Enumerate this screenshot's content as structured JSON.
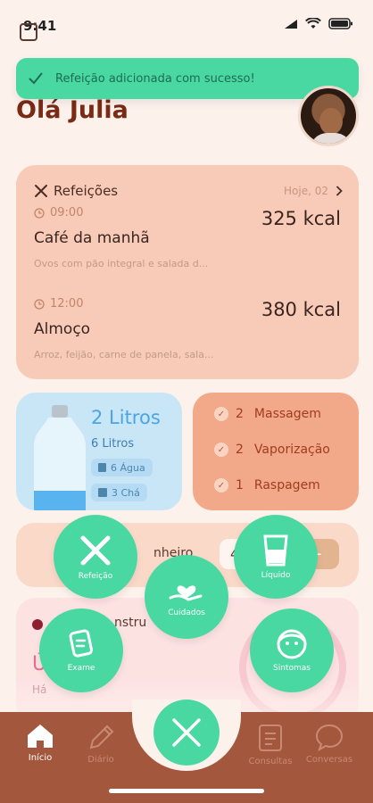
{
  "status_bar": {
    "time": "9:41"
  },
  "toast": {
    "message": "Refeição adicionada com sucesso!"
  },
  "greeting": "Olá Julia",
  "meals": {
    "title": "Refeições",
    "date": "Hoje, 02",
    "items": [
      {
        "time": "09:00",
        "name": "Café da manhã",
        "kcal": "325 kcal",
        "desc": "Ovos com pão integral e salada d..."
      },
      {
        "time": "12:00",
        "name": "Almoço",
        "kcal": "380 kcal",
        "desc": "Arroz, feijão, carne de panela, sala..."
      }
    ]
  },
  "water": {
    "main": "2 Litros",
    "sub": "6 Litros",
    "chips": [
      "6 Água",
      "3 Chá"
    ]
  },
  "care": {
    "items": [
      {
        "count": "2",
        "label": "Massagem"
      },
      {
        "count": "2",
        "label": "Vaporização"
      },
      {
        "count": "1",
        "label": "Raspagem"
      }
    ]
  },
  "partial": {
    "bath_label": "nheiro",
    "bath_value": "4",
    "bath_minus": "−",
    "cycle_label": "nstru",
    "cycle_big": "Ú         clo",
    "cycle_small": "Há"
  },
  "fab_menu": {
    "meal": "Refeição",
    "liquid": "Líquido",
    "care": "Cuidados",
    "exam": "Exame",
    "symptoms": "Sintomas"
  },
  "nav": {
    "home": "Início",
    "diary": "Diário",
    "consults": "Consultas",
    "chats": "Conversas"
  },
  "colors": {
    "accent": "#49d7a2",
    "nav_bg": "#a3573c",
    "brand_text": "#7a2a15"
  }
}
